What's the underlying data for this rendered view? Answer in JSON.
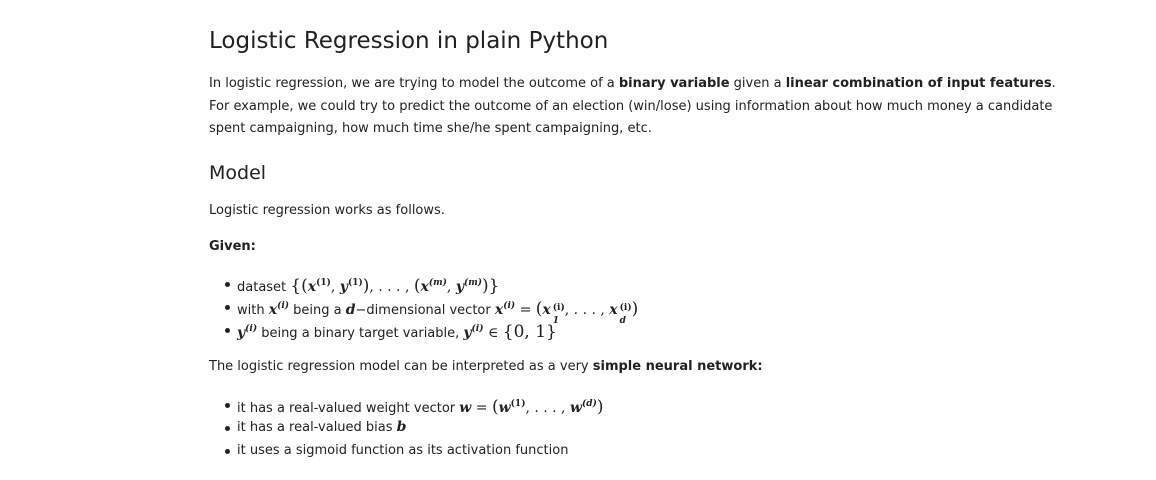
{
  "title": "Logistic Regression in plain Python",
  "intro": {
    "t1": "In logistic regression, we are trying to model the outcome of a ",
    "b1": "binary variable",
    "t2": " given a ",
    "b2": "linear combination of input features",
    "t3": ". For example, we could try to predict the outcome of an election (win/lose) using information about how much money a candidate spent campaigning, how much time she/he spent campaigning, etc."
  },
  "model_heading": "Model",
  "works": "Logistic regression works as follows.",
  "given": "Given:",
  "given_items": {
    "dataset_label": "dataset ",
    "with_label": "with ",
    "being_a": " being a ",
    "dim_text": "−dimensional vector ",
    "target_text": " being a binary target variable, "
  },
  "nn": {
    "t1": "The logistic regression model can be interpreted as a very ",
    "b1": "simple neural network:"
  },
  "nn_items": {
    "weight_text": "it has a real-valued weight vector ",
    "bias_text": "it has a real-valued bias ",
    "sigmoid_text": "it uses a sigmoid function as its activation function"
  },
  "math": {
    "x": "x",
    "y": "y",
    "d": "d",
    "w": "w",
    "b": "b",
    "i": "(i)",
    "one": "(1)",
    "m": "(m)",
    "dsup": "(d)",
    "set": "{0, 1}"
  }
}
